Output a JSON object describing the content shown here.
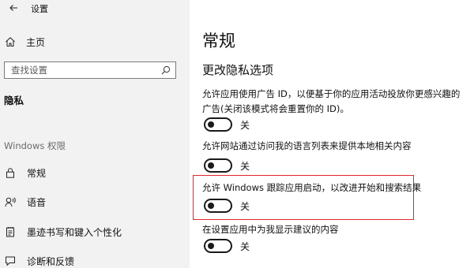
{
  "window": {
    "title": "设置"
  },
  "sidebar": {
    "home_label": "主页",
    "search_placeholder": "查找设置",
    "current": "隐私",
    "section_heading": "Windows 权限",
    "items": [
      {
        "label": "常规",
        "icon": "lock-icon"
      },
      {
        "label": "语音",
        "icon": "speech-icon"
      },
      {
        "label": "墨迹书写和键入个性化",
        "icon": "notepad-icon"
      },
      {
        "label": "诊断和反馈",
        "icon": "feedback-icon"
      }
    ]
  },
  "main": {
    "title": "常规",
    "section_title": "更改隐私选项",
    "settings": [
      {
        "desc": "允许应用使用广告 ID，以便基于你的应用活动投放你更感兴趣的广告(关闭该模式将会重置你的 ID)。",
        "state": "关",
        "highlighted": false
      },
      {
        "desc": "允许网站通过访问我的语言列表来提供本地相关内容",
        "state": "关",
        "highlighted": false
      },
      {
        "desc": "允许 Windows 跟踪应用启动，以改进开始和搜索结果",
        "state": "关",
        "highlighted": true
      },
      {
        "desc": "在设置应用中为我显示建议的内容",
        "state": "关",
        "highlighted": false
      }
    ]
  },
  "colors": {
    "sidebar_bg": "#f2f2f2",
    "highlight_border": "#e0262e",
    "toggle_off": "#1a1a1a"
  }
}
